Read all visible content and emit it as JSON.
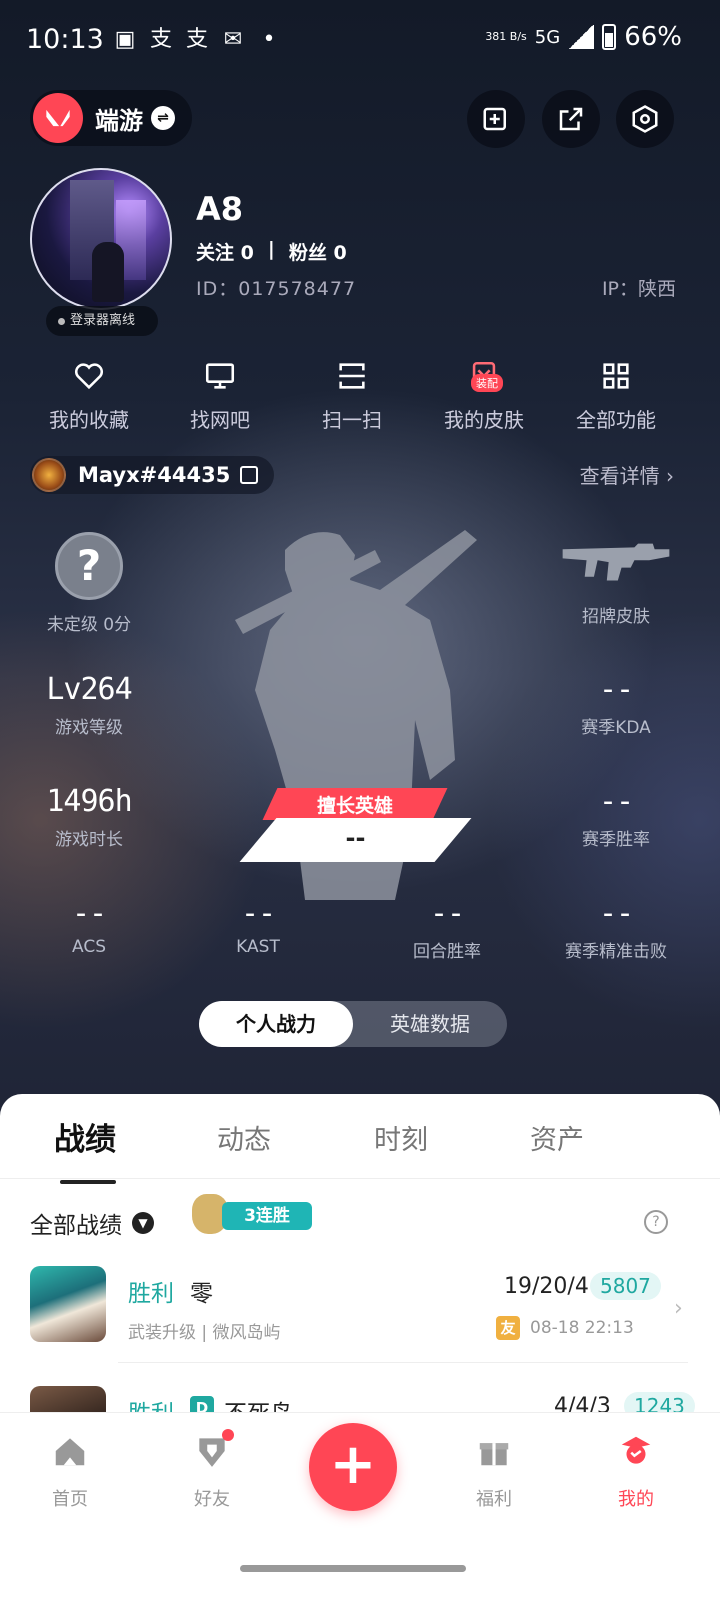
{
  "status_bar": {
    "time": "10:13",
    "notifications": [
      "message-icon",
      "alipay-icon",
      "alipay-icon",
      "mail-icon",
      "dot-icon"
    ],
    "net_speed": "381 B/s",
    "network": "5G",
    "battery": "66%"
  },
  "header": {
    "game_name": "端游",
    "brand_color": "#ff4655"
  },
  "profile": {
    "username": "A8",
    "following_label": "关注",
    "following_count": "0",
    "separator": "|",
    "followers_label": "粉丝",
    "followers_count": "0",
    "id_text": "ID：017578477",
    "ip_text": "IP：陕西",
    "login_status": "登录器离线"
  },
  "quick_actions": [
    {
      "label": "我的收藏",
      "icon": "heart-icon"
    },
    {
      "label": "找网吧",
      "icon": "monitor-icon"
    },
    {
      "label": "扫一扫",
      "icon": "scan-icon"
    },
    {
      "label": "我的皮肤",
      "icon": "skin-icon",
      "badge": "装配"
    },
    {
      "label": "全部功能",
      "icon": "grid-icon"
    }
  ],
  "game_account": {
    "riot_id": "Mayx#44435",
    "detail_link": "查看详情 ›"
  },
  "stats": {
    "rank_glyph": "?",
    "rank_label": "未定级 0分",
    "signature_skin_label": "招牌皮肤",
    "level_value": "Lv264",
    "level_label": "游戏等级",
    "kda_value": "--",
    "kda_label": "赛季KDA",
    "hours_value": "1496h",
    "hours_label": "游戏时长",
    "winrate_value": "--",
    "winrate_label": "赛季胜率",
    "best_hero_tag": "擅长英雄",
    "best_hero_value": "--",
    "acs_value": "--",
    "acs_label": "ACS",
    "kast_value": "--",
    "kast_label": "KAST",
    "round_win_value": "--",
    "round_win_label": "回合胜率",
    "precise_value": "--",
    "precise_label": "赛季精准击败"
  },
  "segment": {
    "options": [
      "个人战力",
      "英雄数据"
    ],
    "selected": "个人战力"
  },
  "tabs": [
    "战绩",
    "动态",
    "时刻",
    "资产"
  ],
  "match_list": {
    "filter_label": "全部战绩",
    "streak_label": "3连胜",
    "matches": [
      {
        "result": "胜利",
        "hero": "零",
        "mode": "武装升级 | 微风岛屿",
        "kda": "19/20/4",
        "score": "5807",
        "friend_tag": "友",
        "date": "08-18 22:13"
      },
      {
        "result": "胜利",
        "hero_prefix": "D",
        "hero": "不死鸟",
        "kda": "4/4/3",
        "score": "1243"
      }
    ]
  },
  "bottom_nav": [
    {
      "label": "首页",
      "icon": "home-icon"
    },
    {
      "label": "好友",
      "icon": "friends-icon"
    },
    {
      "label": "",
      "icon": "plus-icon"
    },
    {
      "label": "福利",
      "icon": "gift-icon"
    },
    {
      "label": "我的",
      "icon": "profile-icon"
    }
  ]
}
